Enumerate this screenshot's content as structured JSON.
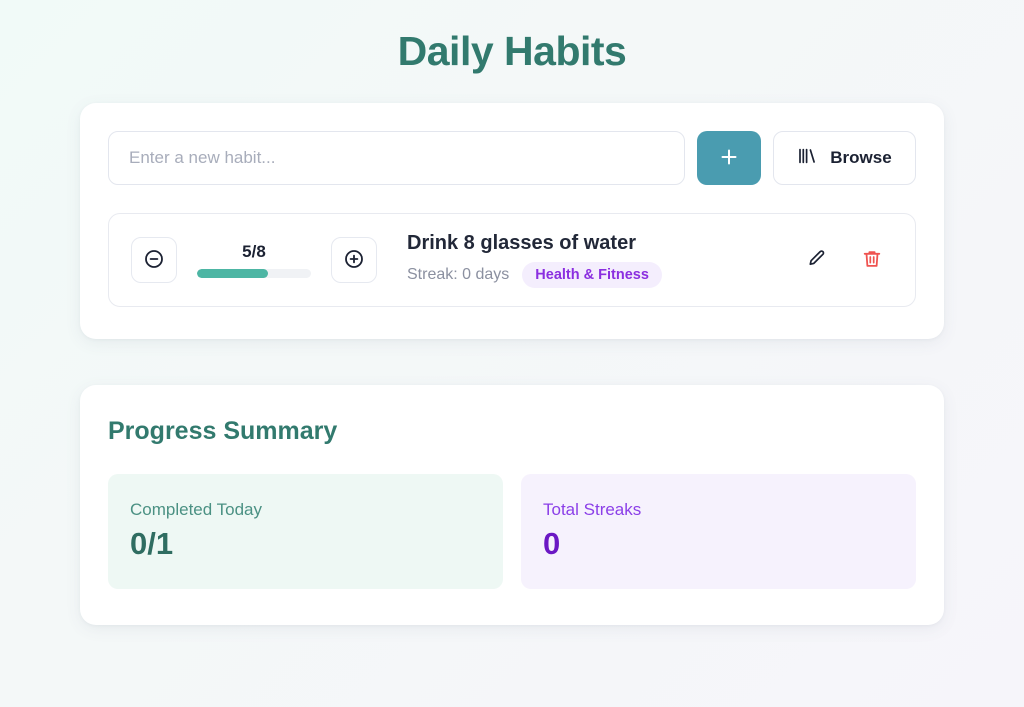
{
  "app": {
    "title": "Daily Habits",
    "accent_teal": "#327a6e",
    "accent_button": "#4a9cb0",
    "accent_progress": "#4db6a4",
    "accent_purple": "#8b2fe0",
    "accent_danger": "#ef5350"
  },
  "add_habit": {
    "input_value": "",
    "input_placeholder": "Enter a new habit...",
    "add_label": "+",
    "browse_label": "Browse",
    "add_icon": "plus-icon",
    "browse_icon": "library-books-icon"
  },
  "habits": [
    {
      "name": "Drink 8 glasses of water",
      "counter": "5/8",
      "current": 5,
      "target": 8,
      "progress_percent": 62.5,
      "streak": "Streak: 0 days",
      "tag": "Health & Fitness",
      "decrement_icon": "circle-minus-icon",
      "increment_icon": "circle-plus-icon",
      "edit_icon": "pencil-icon",
      "delete_icon": "trash-icon"
    }
  ],
  "summary": {
    "title": "Progress Summary",
    "stats": [
      {
        "label": "Completed Today",
        "value": "0/1"
      },
      {
        "label": "Total Streaks",
        "value": "0"
      }
    ]
  }
}
